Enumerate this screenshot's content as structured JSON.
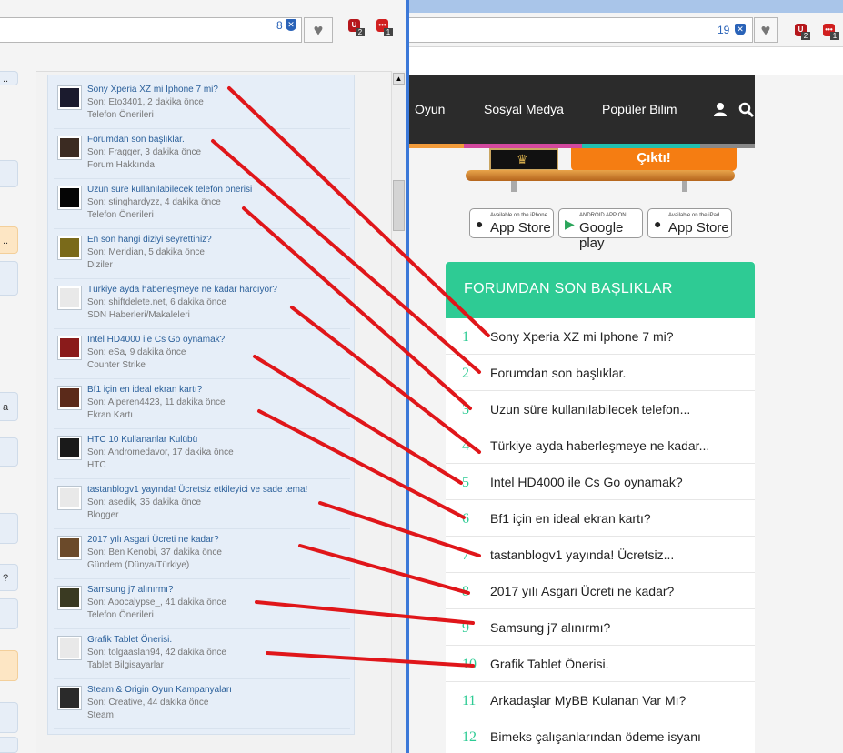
{
  "left_browser": {
    "shield_count": "8",
    "ext_badges": [
      "2",
      "1"
    ],
    "topics": [
      {
        "title": "Sony Xperia XZ mi Iphone 7 mi?",
        "meta": "Son: Eto3401, 2 dakika önce",
        "forum": "Telefon Önerileri",
        "thumb": "#1b1b2e"
      },
      {
        "title": "Forumdan son başlıklar.",
        "meta": "Son: Fragger, 3 dakika önce",
        "forum": "Forum Hakkında",
        "thumb": "#3b2b22"
      },
      {
        "title": "Uzun süre kullanılabilecek telefon önerisi",
        "meta": "Son: stinghardyzz, 4 dakika önce",
        "forum": "Telefon Önerileri",
        "thumb": "#050505"
      },
      {
        "title": "En son hangi diziyi seyrettiniz?",
        "meta": "Son: Meridian, 5 dakika önce",
        "forum": "Diziler",
        "thumb": "#7a6a1a"
      },
      {
        "title": "Türkiye ayda haberleşmeye ne kadar harcıyor?",
        "meta": "Son: shiftdelete.net, 6 dakika önce",
        "forum": "SDN Haberleri/Makaleleri",
        "thumb": "#e9e9e9"
      },
      {
        "title": "Intel HD4000 ile Cs Go oynamak?",
        "meta": "Son: eSa, 9 dakika önce",
        "forum": "Counter Strike",
        "thumb": "#8a1b1b"
      },
      {
        "title": "Bf1 için en ideal ekran kartı?",
        "meta": "Son: Alperen4423, 11 dakika önce",
        "forum": "Ekran Kartı",
        "thumb": "#5b2a1a"
      },
      {
        "title": "HTC 10 Kullananlar Kulübü",
        "meta": "Son: Andromedavor, 17 dakika önce",
        "forum": "HTC",
        "thumb": "#1a1a1a"
      },
      {
        "title": "tastanblogv1 yayında! Ücretsiz etkileyici ve sade tema!",
        "meta": "Son: asedik, 35 dakika önce",
        "forum": "Blogger",
        "thumb": "#e9e9e9"
      },
      {
        "title": "2017 yılı Asgari Ücreti ne kadar?",
        "meta": "Son: Ben Kenobi, 37 dakika önce",
        "forum": "Gündem (Dünya/Türkiye)",
        "thumb": "#6b4a2a"
      },
      {
        "title": "Samsung j7 alınırmı?",
        "meta": "Son: Apocalypse_, 41 dakika önce",
        "forum": "Telefon Önerileri",
        "thumb": "#3a3a22"
      },
      {
        "title": "Grafik Tablet Önerisi.",
        "meta": "Son: tolgaaslan94, 42 dakika önce",
        "forum": "Tablet Bilgisayarlar",
        "thumb": "#e9e9e9"
      },
      {
        "title": "Steam & Origin Oyun Kampanyaları",
        "meta": "Son: Creative, 44 dakika önce",
        "forum": "Steam",
        "thumb": "#2a2a2a"
      }
    ],
    "stubs": [
      {
        "text": ".."
      },
      {
        "text": ""
      },
      {
        "text": ".."
      },
      {
        "text": ""
      },
      {
        "text": "a"
      },
      {
        "text": ""
      },
      {
        "text": ""
      },
      {
        "text": "?"
      },
      {
        "text": ""
      },
      {
        "text": ""
      },
      {
        "text": ""
      },
      {
        "text": ""
      }
    ]
  },
  "right_browser": {
    "shield_count": "19",
    "ext_badges": [
      "2",
      "1"
    ],
    "nav": [
      "Oyun",
      "Sosyal Medya",
      "Popüler Bilim"
    ],
    "banner_button": "Çıktı!",
    "stores": [
      {
        "small": "Available on the iPhone",
        "big": "App Store",
        "icon": ""
      },
      {
        "small": "ANDROID APP ON",
        "big": "Google play",
        "icon": "▶"
      },
      {
        "small": "Available on the iPad",
        "big": "App Store",
        "icon": ""
      }
    ],
    "widget_title": "FORUMDAN SON BAŞLIKLAR",
    "threads": [
      {
        "num": "1",
        "title": "Sony Xperia XZ mi Iphone 7 mi?"
      },
      {
        "num": "2",
        "title": "Forumdan son başlıklar."
      },
      {
        "num": "3",
        "title": "Uzun süre kullanılabilecek telefon..."
      },
      {
        "num": "4",
        "title": "Türkiye ayda haberleşmeye ne kadar..."
      },
      {
        "num": "5",
        "title": "Intel HD4000 ile Cs Go oynamak?"
      },
      {
        "num": "6",
        "title": "Bf1 için en ideal ekran kartı?"
      },
      {
        "num": "7",
        "title": "tastanblogv1 yayında! Ücretsiz..."
      },
      {
        "num": "8",
        "title": "2017 yılı Asgari Ücreti ne kadar?"
      },
      {
        "num": "9",
        "title": "Samsung j7 alınırmı?"
      },
      {
        "num": "10",
        "title": "Grafik Tablet Önerisi."
      },
      {
        "num": "11",
        "title": "Arkadaşlar MyBB Kulanan Var Mı?"
      },
      {
        "num": "12",
        "title": "Bimeks çalışanlarından ödeme isyanı"
      }
    ]
  },
  "colors": {
    "accent_green": "#2ecb94",
    "annotation_red": "#e0161a",
    "nav_bg": "#2b2b2b",
    "window_border": "#3b78d8"
  }
}
